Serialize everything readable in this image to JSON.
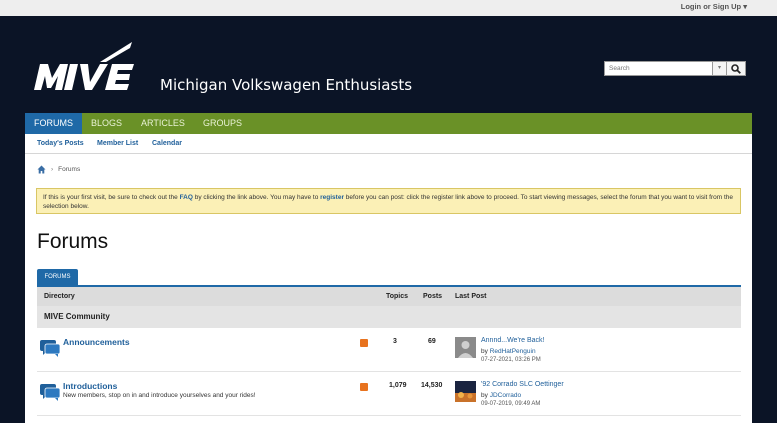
{
  "topbar": {
    "login_label": "Login or Sign Up ▾"
  },
  "header": {
    "site_name": "Michigan Volkswagen Enthusiasts",
    "logo_text": "MIVE"
  },
  "search": {
    "placeholder": "Search",
    "dropdown_icon": "chevron-down-icon",
    "button_icon": "search-icon"
  },
  "nav": {
    "tabs": [
      {
        "label": "FORUMS"
      },
      {
        "label": "BLOGS"
      },
      {
        "label": "ARTICLES"
      },
      {
        "label": "GROUPS"
      }
    ]
  },
  "subnav": {
    "links": [
      {
        "label": "Today's Posts"
      },
      {
        "label": "Member List"
      },
      {
        "label": "Calendar"
      }
    ]
  },
  "breadcrumb": {
    "current": "Forums"
  },
  "notice": {
    "part1": "If this is your first visit, be sure to check out the ",
    "faq": "FAQ",
    "part2": " by clicking the link above. You may have to ",
    "register": "register",
    "part3": " before you can post: click the register link above to proceed. To start viewing messages, select the forum that you want to visit from the selection below."
  },
  "page_title": "Forums",
  "forums_tab": "FORUMS",
  "table": {
    "headers": {
      "directory": "Directory",
      "topics": "Topics",
      "posts": "Posts",
      "last_post": "Last Post"
    },
    "category": "MIVE Community",
    "rows": [
      {
        "name": "Announcements",
        "description": "",
        "topics": "3",
        "posts": "69",
        "last_title": "Annnd...We're Back!",
        "by": "by",
        "user": "RedHatPenguin",
        "date": "07-27-2021, 03:26 PM"
      },
      {
        "name": "Introductions",
        "description": "New members, stop on in and introduce yourselves and your rides!",
        "topics": "1,079",
        "posts": "14,530",
        "last_title": "'92 Corrado SLC Oettinger",
        "by": "by",
        "user": "JDCorrado",
        "date": "09-07-2019, 09:49 AM"
      }
    ]
  },
  "colors": {
    "nav_green": "#6a9127",
    "accent_blue": "#1f69a7",
    "background": "#0b1426",
    "notice_bg": "#fbf0b6"
  }
}
